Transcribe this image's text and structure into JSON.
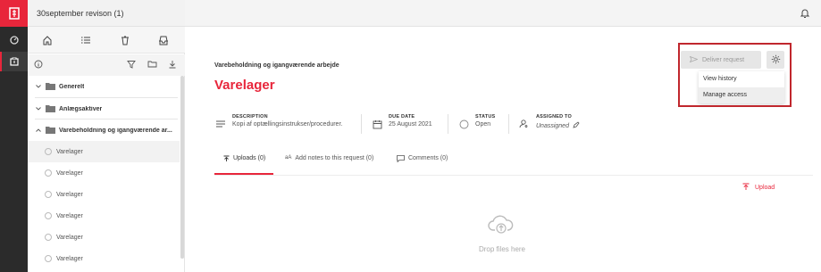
{
  "app": {
    "rail_icons": [
      "logo-icon",
      "dashboard-icon",
      "binder-icon"
    ]
  },
  "panel": {
    "title": "30september revison (1)",
    "nav_icons": [
      "home-icon",
      "list-icon",
      "trash-icon",
      "inbox-icon"
    ],
    "toolbar_icons": [
      "info-icon",
      "filter-icon",
      "folder-open-icon",
      "download-icon"
    ],
    "tree": [
      {
        "label": "Generelt",
        "expanded": false
      },
      {
        "label": "Anlægsaktiver",
        "expanded": false
      },
      {
        "label": "Varebeholdning og igangværende ar...",
        "expanded": true
      }
    ],
    "leaves": [
      {
        "label": "Varelager",
        "selected": true
      },
      {
        "label": "Varelager",
        "selected": false
      },
      {
        "label": "Varelager",
        "selected": false
      },
      {
        "label": "Varelager",
        "selected": false
      },
      {
        "label": "Varelager",
        "selected": false
      },
      {
        "label": "Varelager",
        "selected": false
      }
    ]
  },
  "main": {
    "breadcrumb": "Varebeholdning og igangværende arbejde",
    "title": "Varelager",
    "meta": {
      "description": {
        "label": "DESCRIPTION",
        "value": "Kopi af optællingsinstrukser/procedurer."
      },
      "due_date": {
        "label": "DUE DATE",
        "value": "25 August 2021"
      },
      "status": {
        "label": "STATUS",
        "value": "Open"
      },
      "assigned_to": {
        "label": "ASSIGNED TO",
        "value": "Unassigned"
      }
    },
    "tabs": [
      {
        "label": "Uploads (0)",
        "active": true
      },
      {
        "label": "Add notes to this request (0)",
        "active": false
      },
      {
        "label": "Comments (0)",
        "active": false
      }
    ],
    "upload_label": "Upload",
    "drop_text": "Drop files here",
    "deliver_label": "Deliver request",
    "menu": [
      {
        "label": "View history"
      },
      {
        "label": "Manage access"
      }
    ]
  },
  "colors": {
    "accent": "#e8263b",
    "rail": "#2b2b2b",
    "highlight": "#c0272d"
  }
}
